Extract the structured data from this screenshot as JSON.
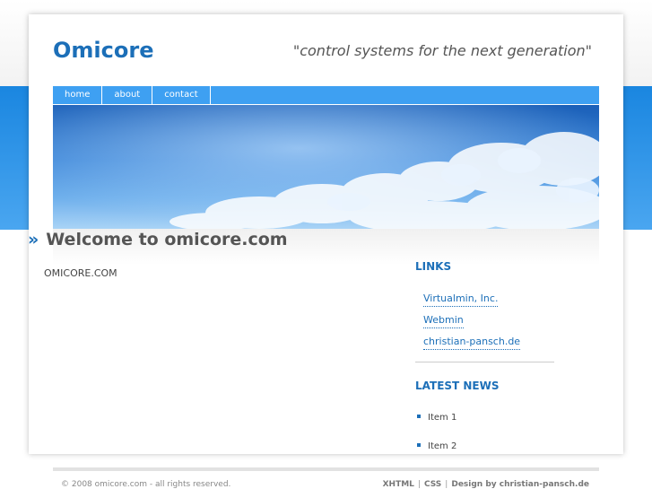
{
  "header": {
    "logo": "Omicore",
    "slogan": "\"control systems for the next generation\""
  },
  "nav": {
    "items": [
      {
        "label": "home"
      },
      {
        "label": "about"
      },
      {
        "label": "contact"
      }
    ]
  },
  "main": {
    "heading_prefix": "»",
    "heading": "Welcome to omicore.com",
    "body": "OMICORE.COM"
  },
  "sidebar": {
    "links_heading": "LINKS",
    "links": [
      {
        "label": "Virtualmin, Inc."
      },
      {
        "label": "Webmin"
      },
      {
        "label": "christian-pansch.de"
      }
    ],
    "news_heading": "LATEST NEWS",
    "news": [
      {
        "label": "Item 1"
      },
      {
        "label": "Item 2"
      }
    ]
  },
  "footer": {
    "copyright": "© 2008 omicore.com - all rights reserved.",
    "xhtml": "XHTML",
    "css": "CSS",
    "separator": "|",
    "design": "Design by christian-pansch.de"
  },
  "colors": {
    "brand_blue": "#1c6fb8",
    "nav_blue": "#3ea0f2",
    "band_blue": "#1a86e0"
  }
}
